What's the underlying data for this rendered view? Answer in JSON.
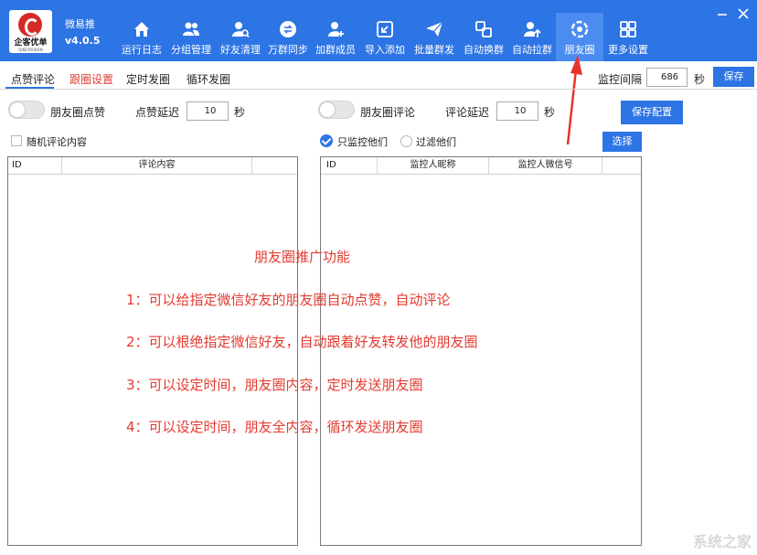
{
  "app": {
    "name": "微易推",
    "version": "v4.0.5",
    "logo_text": "企客优单",
    "logo_sub": "QIKEYOUDAN"
  },
  "nav": [
    {
      "label": "运行日志",
      "icon": "home-icon"
    },
    {
      "label": "分组管理",
      "icon": "users-icon"
    },
    {
      "label": "好友清理",
      "icon": "user-search-icon"
    },
    {
      "label": "万群同步",
      "icon": "sync-icon"
    },
    {
      "label": "加群成员",
      "icon": "user-add-icon"
    },
    {
      "label": "导入添加",
      "icon": "import-icon"
    },
    {
      "label": "批量群发",
      "icon": "send-icon"
    },
    {
      "label": "自动换群",
      "icon": "switch-icon"
    },
    {
      "label": "自动拉群",
      "icon": "pull-group-icon"
    },
    {
      "label": "朋友圈",
      "icon": "moments-icon"
    },
    {
      "label": "更多设置",
      "icon": "grid-icon"
    }
  ],
  "tabs": [
    {
      "label": "点赞评论"
    },
    {
      "label": "跟圈设置"
    },
    {
      "label": "定时发圈"
    },
    {
      "label": "循环发圈"
    }
  ],
  "monitor": {
    "label": "监控间隔",
    "value": "686",
    "unit": "秒",
    "save": "保存"
  },
  "like": {
    "toggle_label": "朋友圈点赞",
    "delay_label": "点赞延迟",
    "delay_value": "10",
    "unit": "秒"
  },
  "comment": {
    "toggle_label": "朋友圈评论",
    "delay_label": "评论延迟",
    "delay_value": "10",
    "unit": "秒"
  },
  "save_config": "保存配置",
  "random_comment": "随机评论内容",
  "only_monitor": "只监控他们",
  "filter_them": "过滤他们",
  "select": "选择",
  "left_table": {
    "headers": [
      "ID",
      "评论内容"
    ]
  },
  "right_table": {
    "headers": [
      "ID",
      "监控人昵称",
      "监控人微信号"
    ]
  },
  "overlay": {
    "title": "朋友圈推广功能",
    "lines": [
      "1：可以给指定微信好友的朋友圈自动点赞，自动评论",
      "2：可以根绝指定微信好友，自动跟着好友转发他的朋友圈",
      "3：可以设定时间，朋友圈内容，定时发送朋友圈",
      "4：可以设定时间，朋友全内容，循环发送朋友圈"
    ]
  },
  "watermark": "系统之家",
  "colors": {
    "header": "#2d74e4",
    "accent_red": "#e23b30",
    "active_nav": "#4b8cf0"
  }
}
